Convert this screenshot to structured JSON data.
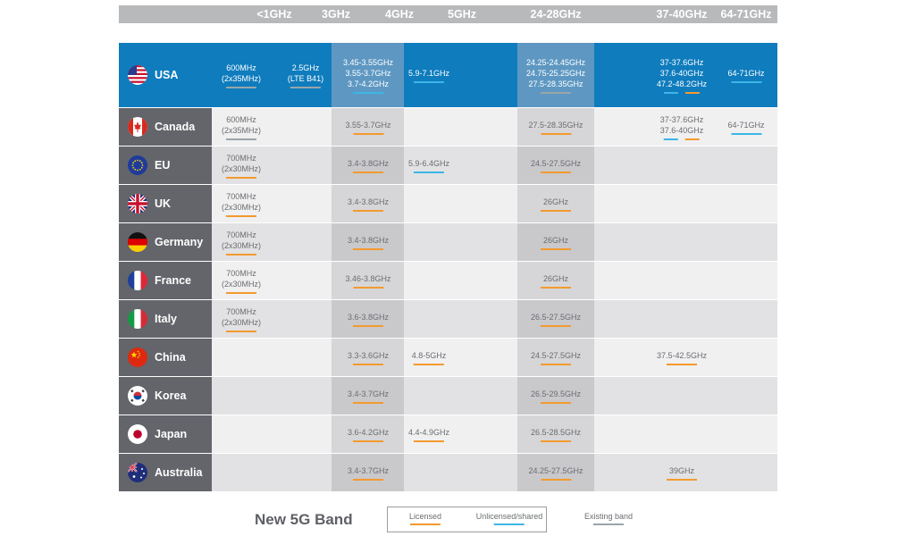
{
  "band_headers": [
    "<1GHz",
    "3GHz",
    "4GHz",
    "5GHz",
    "24-28GHz",
    "37-40GHz",
    "64-71GHz"
  ],
  "colors": {
    "licensed": "#f39a2e",
    "unlicensed": "#3cb6e6",
    "existing": "#9aa5a8",
    "usa_row": "#0f7cbd",
    "country_cell": "#63656b"
  },
  "rows": [
    {
      "country": "USA",
      "flag": "usa-flag-icon",
      "bands": {
        "sub1": {
          "text": "600MHz\n(2x35MHz)",
          "type": "existing"
        },
        "ghz3": {
          "text": "2.5GHz\n(LTE B41)",
          "type": "existing"
        },
        "ghz4": {
          "text": "3.45-3.55GHz\n3.55-3.7GHz\n3.7-4.2GHz",
          "type": "unlicensed"
        },
        "ghz5": {
          "text": "5.9-7.1GHz",
          "type": "unlicensed"
        },
        "mm28": {
          "text": "24.25-24.45GHz\n24.75-25.25GHz\n27.5-28.35GHz",
          "type": "existing"
        },
        "mm40": {
          "text": "37-37.6GHz\n37.6-40GHz\n47.2-48.2GHz",
          "type": "pair"
        },
        "mm71": {
          "text": "64-71GHz",
          "type": "unlicensed"
        }
      }
    },
    {
      "country": "Canada",
      "flag": "canada-flag-icon",
      "bands": {
        "sub1": {
          "text": "600MHz\n(2x35MHz)",
          "type": "existing"
        },
        "ghz4": {
          "text": "3.55-3.7GHz",
          "type": "licensed"
        },
        "mm28": {
          "text": "27.5-28.35GHz",
          "type": "licensed"
        },
        "mm40": {
          "text": "37-37.6GHz\n37.6-40GHz",
          "type": "pair"
        },
        "mm71": {
          "text": "64-71GHz",
          "type": "unlicensed"
        }
      }
    },
    {
      "country": "EU",
      "flag": "eu-flag-icon",
      "bands": {
        "sub1": {
          "text": "700MHz\n(2x30MHz)",
          "type": "licensed"
        },
        "ghz4": {
          "text": "3.4-3.8GHz",
          "type": "licensed"
        },
        "ghz5": {
          "text": "5.9-6.4GHz",
          "type": "unlicensed"
        },
        "mm28": {
          "text": "24.5-27.5GHz",
          "type": "licensed"
        }
      }
    },
    {
      "country": "UK",
      "flag": "uk-flag-icon",
      "bands": {
        "sub1": {
          "text": "700MHz\n(2x30MHz)",
          "type": "licensed"
        },
        "ghz4": {
          "text": "3.4-3.8GHz",
          "type": "licensed"
        },
        "mm28": {
          "text": "26GHz",
          "type": "licensed"
        }
      }
    },
    {
      "country": "Germany",
      "flag": "germany-flag-icon",
      "bands": {
        "sub1": {
          "text": "700MHz\n(2x30MHz)",
          "type": "licensed"
        },
        "ghz4": {
          "text": "3.4-3.8GHz",
          "type": "licensed"
        },
        "mm28": {
          "text": "26GHz",
          "type": "licensed"
        }
      }
    },
    {
      "country": "France",
      "flag": "france-flag-icon",
      "bands": {
        "sub1": {
          "text": "700MHz\n(2x30MHz)",
          "type": "licensed"
        },
        "ghz4": {
          "text": "3.46-3.8GHz",
          "type": "licensed"
        },
        "mm28": {
          "text": "26GHz",
          "type": "licensed"
        }
      }
    },
    {
      "country": "Italy",
      "flag": "italy-flag-icon",
      "bands": {
        "sub1": {
          "text": "700MHz\n(2x30MHz)",
          "type": "licensed"
        },
        "ghz4": {
          "text": "3.6-3.8GHz",
          "type": "licensed"
        },
        "mm28": {
          "text": "26.5-27.5GHz",
          "type": "licensed"
        }
      }
    },
    {
      "country": "China",
      "flag": "china-flag-icon",
      "bands": {
        "ghz4": {
          "text": "3.3-3.6GHz",
          "type": "licensed"
        },
        "ghz5": {
          "text": "4.8-5GHz",
          "type": "licensed"
        },
        "mm28": {
          "text": "24.5-27.5GHz",
          "type": "licensed"
        },
        "mm40": {
          "text": "37.5-42.5GHz",
          "type": "licensed"
        }
      }
    },
    {
      "country": "Korea",
      "flag": "korea-flag-icon",
      "bands": {
        "ghz4": {
          "text": "3.4-3.7GHz",
          "type": "licensed"
        },
        "mm28": {
          "text": "26.5-29.5GHz",
          "type": "licensed"
        }
      }
    },
    {
      "country": "Japan",
      "flag": "japan-flag-icon",
      "bands": {
        "ghz4": {
          "text": "3.6-4.2GHz",
          "type": "licensed"
        },
        "ghz5": {
          "text": "4.4-4.9GHz",
          "type": "licensed"
        },
        "mm28": {
          "text": "26.5-28.5GHz",
          "type": "licensed"
        }
      }
    },
    {
      "country": "Australia",
      "flag": "australia-flag-icon",
      "bands": {
        "ghz4": {
          "text": "3.4-3.7GHz",
          "type": "licensed"
        },
        "mm28": {
          "text": "24.25-27.5GHz",
          "type": "licensed"
        },
        "mm40": {
          "text": "39GHz",
          "type": "licensed"
        }
      }
    }
  ],
  "legend": {
    "title": "New 5G Band",
    "licensed": "Licensed",
    "unlicensed": "Unlicensed/shared",
    "existing": "Existing band"
  }
}
